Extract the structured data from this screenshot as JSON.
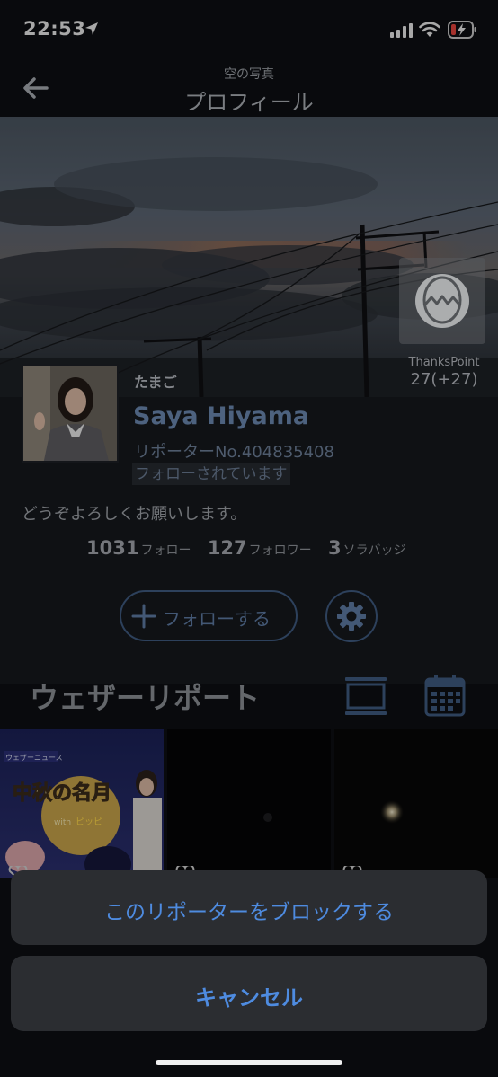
{
  "status_bar": {
    "time": "22:53"
  },
  "nav": {
    "subtitle": "空の写真",
    "title": "プロフィール"
  },
  "thanks": {
    "label": "ThanksPoint",
    "value": "27(+27)"
  },
  "profile": {
    "rank": "たまご",
    "name": "Saya Hiyama",
    "reporter_no": "リポーターNo.404835408",
    "follow_status": "フォローされています",
    "bio": "どうぞよろしくお願いします。"
  },
  "stats": [
    {
      "num": "1031",
      "label": "フォロー"
    },
    {
      "num": "127",
      "label": "フォロワー"
    },
    {
      "num": "3",
      "label": "ソラバッジ"
    }
  ],
  "actions": {
    "follow_label": "フォローする"
  },
  "section": {
    "title": "ウェザーリポート"
  },
  "tile1": {
    "brand": "ウェザーニュース",
    "title": "中秋の名月",
    "with_text": "with",
    "name_text": "ピッピ"
  },
  "sheet": {
    "block_label": "このリポーターをブロックする",
    "cancel_label": "キャンセル"
  },
  "colors": {
    "accent": "#4e8be0",
    "name": "#6b88b0",
    "outline": "#3f5a80"
  }
}
